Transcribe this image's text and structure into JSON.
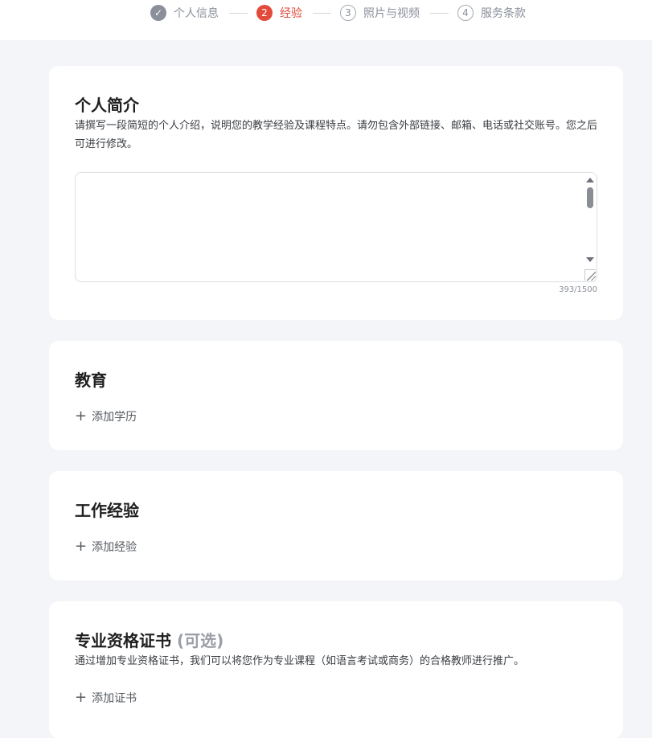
{
  "stepper": {
    "steps": [
      {
        "marker": "✓",
        "label": "个人信息",
        "state": "done"
      },
      {
        "marker": "2",
        "label": "经验",
        "state": "active"
      },
      {
        "marker": "3",
        "label": "照片与视频",
        "state": "pending"
      },
      {
        "marker": "4",
        "label": "服务条款",
        "state": "pending"
      }
    ]
  },
  "bio": {
    "title": "个人简介",
    "description": "请撰写一段简短的个人介绍，说明您的教学经验及课程特点。请勿包含外部链接、邮箱、电话或社交账号。您之后可进行修改。",
    "textarea_value": "",
    "counter": "393/1500"
  },
  "education": {
    "title": "教育",
    "add_label": "添加学历"
  },
  "work": {
    "title": "工作经验",
    "add_label": "添加经验"
  },
  "certificates": {
    "title": "专业资格证书",
    "optional_label": "(可选)",
    "description": "通过增加专业资格证书，我们可以将您作为专业课程（如语言考试或商务）的合格教师进行推广。",
    "add_label": "添加证书"
  },
  "colors": {
    "accent": "#e24a3b",
    "page_background": "#f4f5f8",
    "card_background": "#ffffff",
    "muted_text": "#8a8f99"
  }
}
